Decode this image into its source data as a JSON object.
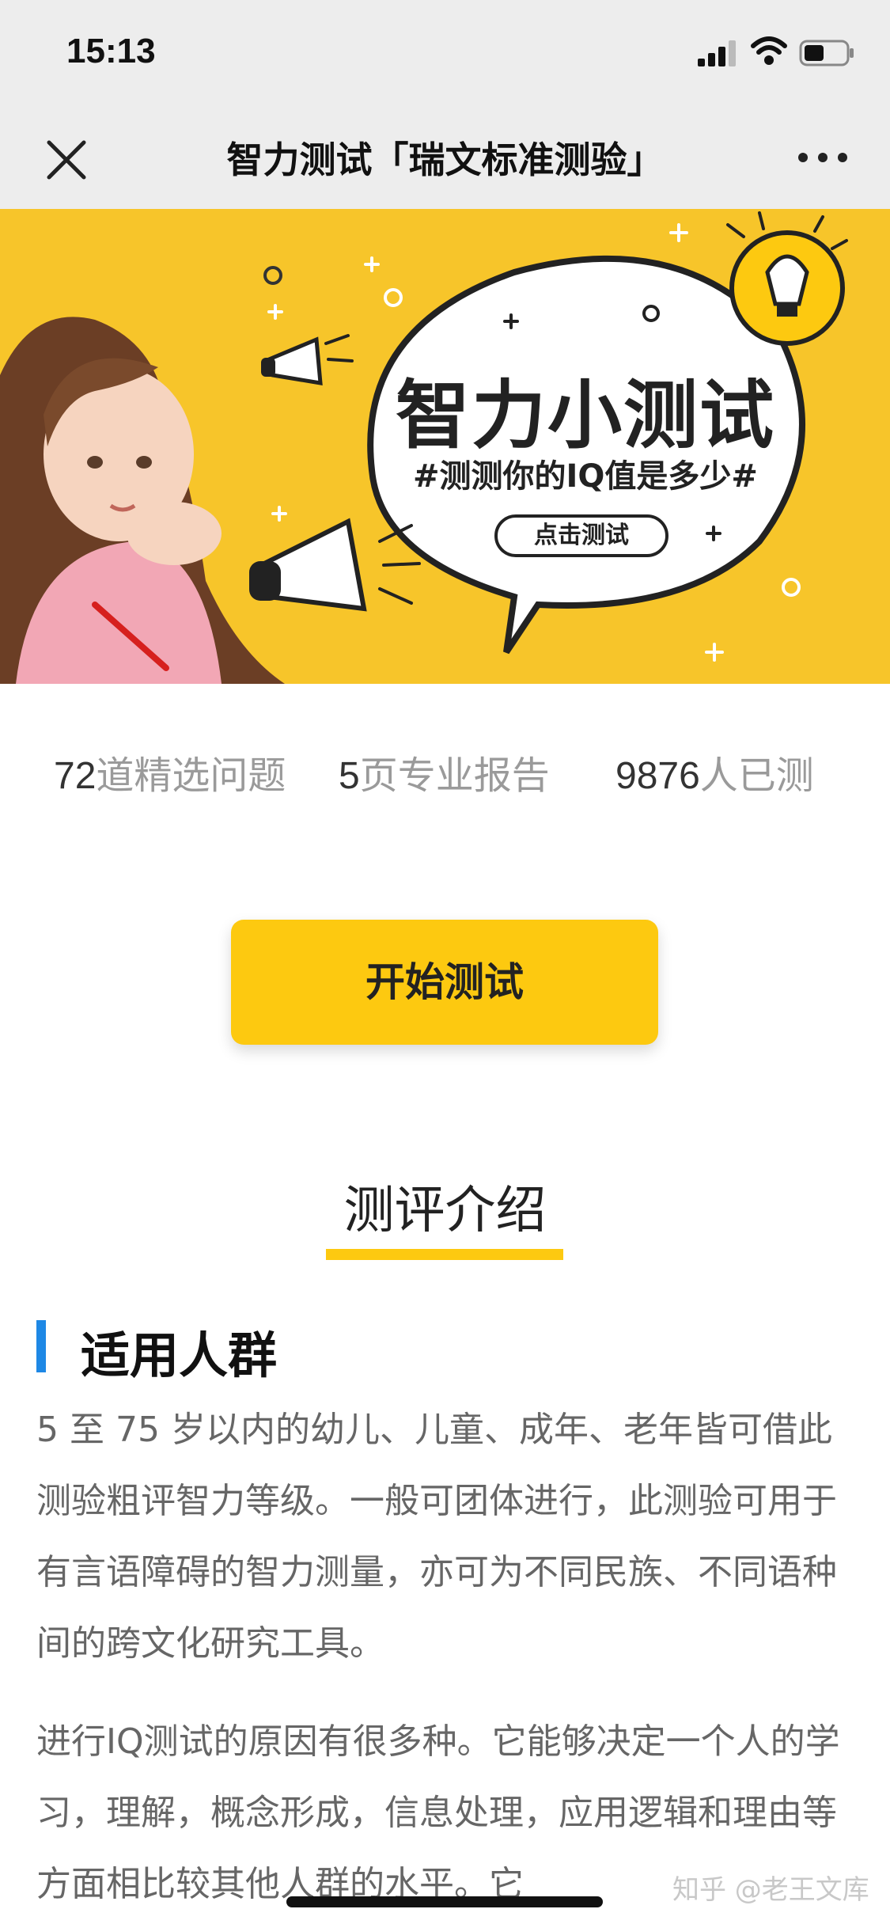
{
  "status_bar": {
    "time": "15:13"
  },
  "nav": {
    "title": "智力测试「瑞文标准测验」",
    "close_icon": "close-icon",
    "more_icon": "more-icon"
  },
  "banner": {
    "title": "智力小测试",
    "subtitle": "#测测你的IQ值是多少#",
    "button": "点击测试"
  },
  "stats": [
    {
      "num": "72",
      "label": "道精选问题"
    },
    {
      "num": "5",
      "label": "页专业报告"
    },
    {
      "num": "9876",
      "label": "人已测"
    }
  ],
  "start_button": "开始测试",
  "section": {
    "heading": "测评介绍",
    "subheading": "适用人群",
    "paragraphs": [
      "5 至 75 岁以内的幼儿、儿童、成年、老年皆可借此测验粗评智力等级。一般可团体进行，此测验可用于有言语障碍的智力测量，亦可为不同民族、不同语种间的跨文化研究工具。",
      "进行IQ测试的原因有很多种。它能够决定一个人的学习，理解，概念形成，信息处理，应用逻辑和理由等方面相比较其他人群的水平。它"
    ]
  },
  "watermark": "知乎 @老王文库",
  "colors": {
    "accent": "#fdc910",
    "banner_bg": "#f7c52a",
    "sub_bar": "#1e88e5",
    "header_bg": "#ededed"
  }
}
